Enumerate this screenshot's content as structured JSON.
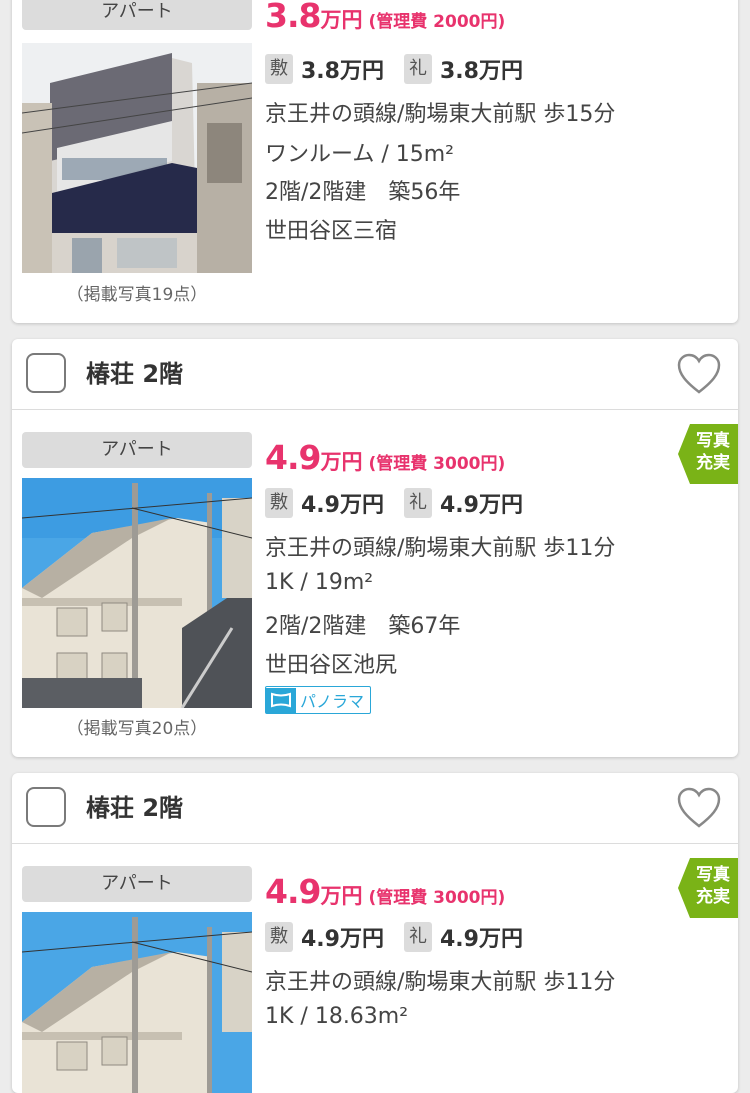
{
  "listings": [
    {
      "type": "アパート",
      "rent_value": "3.8",
      "rent_unit": "万円",
      "management_fee": "(管理費 2000円)",
      "deposit_label": "敷",
      "deposit_value": "3.8万円",
      "key_money_label": "礼",
      "key_money_value": "3.8万円",
      "access": "京王井の頭線/駒場東大前駅 歩15分",
      "layout": "ワンルーム / 15m²",
      "floor_age": "2階/2階建　築56年",
      "address": "世田谷区三宿",
      "photo_count": "（掲載写真19点）"
    },
    {
      "name": "椿荘 2階",
      "type": "アパート",
      "rent_value": "4.9",
      "rent_unit": "万円",
      "management_fee": "(管理費 3000円)",
      "deposit_label": "敷",
      "deposit_value": "4.9万円",
      "key_money_label": "礼",
      "key_money_value": "4.9万円",
      "access": "京王井の頭線/駒場東大前駅 歩11分",
      "layout": "1K / 19m²",
      "floor_age": "2階/2階建　築67年",
      "address": "世田谷区池尻",
      "photo_count": "（掲載写真20点）",
      "panorama_label": "パノラマ",
      "ribbon": "写真\n充実"
    },
    {
      "name": "椿荘 2階",
      "type": "アパート",
      "rent_value": "4.9",
      "rent_unit": "万円",
      "management_fee": "(管理費 3000円)",
      "deposit_label": "敷",
      "deposit_value": "4.9万円",
      "key_money_label": "礼",
      "key_money_value": "4.9万円",
      "access": "京王井の頭線/駒場東大前駅 歩11分",
      "layout": "1K / 18.63m²",
      "ribbon": "写真\n充実"
    }
  ],
  "colors": {
    "price": "#e8336d",
    "ribbon": "#7ab317",
    "panorama": "#2aa7d8",
    "badge_bg": "#dcdcdc",
    "page_bg": "#ececec"
  },
  "icons": {
    "favorite": "heart-outline-icon",
    "panorama": "panorama-icon"
  }
}
